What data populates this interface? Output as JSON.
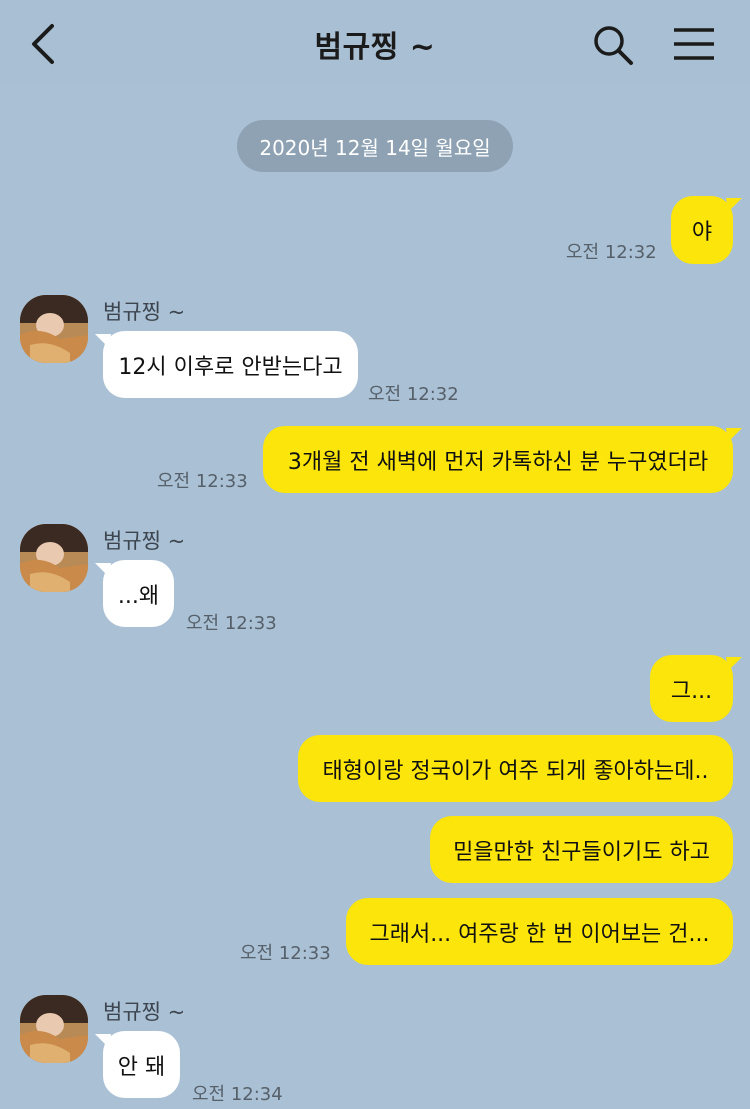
{
  "header": {
    "title": "범규찡 ~",
    "back_icon": "chevron-left-icon",
    "search_icon": "search-icon",
    "menu_icon": "menu-icon"
  },
  "date_divider": "2020년 12월 14일 월요일",
  "colors": {
    "background": "#aac0d4",
    "outgoing_bubble": "#fbe50a",
    "incoming_bubble": "#ffffff"
  },
  "messages": [
    {
      "sender": "me",
      "text": "야",
      "time": "오전 12:32"
    },
    {
      "sender": "범규찡 ~",
      "text": "12시 이후로 안받는다고",
      "time": "오전 12:32"
    },
    {
      "sender": "me",
      "text": "3개월 전 새벽에 먼저 카톡하신 분 누구였더라",
      "time": "오전 12:33"
    },
    {
      "sender": "범규찡 ~",
      "text": "...왜",
      "time": "오전 12:33"
    },
    {
      "sender": "me",
      "text": "그...",
      "time": ""
    },
    {
      "sender": "me",
      "text": "태형이랑 정국이가 여주 되게 좋아하는데..",
      "time": ""
    },
    {
      "sender": "me",
      "text": "믿을만한 친구들이기도 하고",
      "time": ""
    },
    {
      "sender": "me",
      "text": "그래서... 여주랑 한 번 이어보는 건...",
      "time": "오전 12:33"
    },
    {
      "sender": "범규찡 ~",
      "text": "안 돼",
      "time": "오전 12:34"
    }
  ]
}
